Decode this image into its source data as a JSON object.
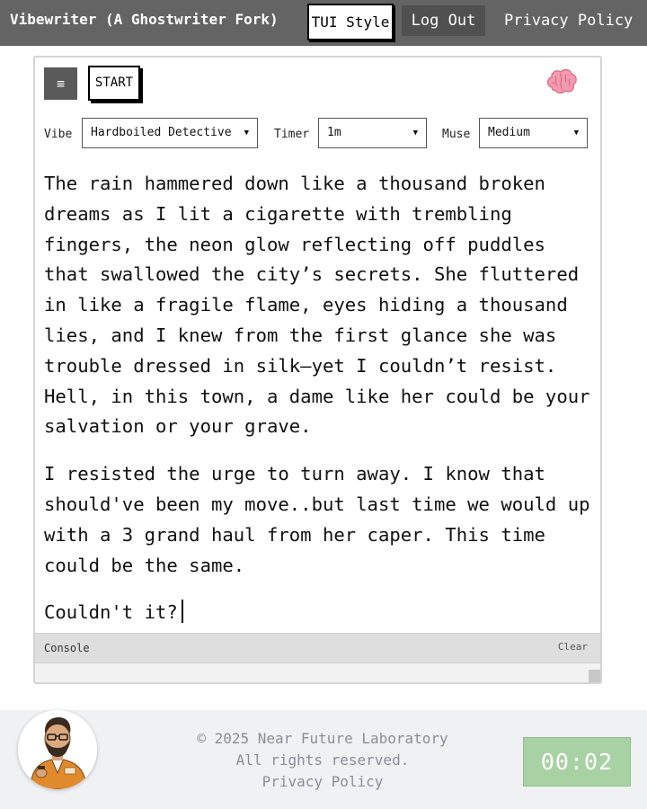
{
  "header": {
    "title": "Vibewriter (A Ghostwriter Fork)",
    "tui_style_label": "TUI Style",
    "logout_label": "Log Out",
    "privacy_label": "Privacy Policy"
  },
  "toolbar": {
    "menu_glyph": "≡",
    "start_label": "START",
    "brain_icon": "brain-icon"
  },
  "controls": {
    "vibe_label": "Vibe",
    "vibe_value": "Hardboiled Detective",
    "timer_label": "Timer",
    "timer_value": "1m",
    "muse_label": "Muse",
    "muse_value": "Medium"
  },
  "editor": {
    "paragraphs": [
      "The rain hammered down like a thousand broken dreams as I lit a cigarette with trembling fingers, the neon glow reflecting off puddles that swallowed the city’s secrets. She fluttered in like a fragile flame, eyes hiding a thousand lies, and I knew from the first glance she was trouble dressed in silk—yet I couldn’t resist. Hell, in this town, a dame like her could be your salvation or your grave.",
      "I resisted the urge to turn away. I know that should've been my move..but last time we would up with a 3 grand haul from her caper. This time could be the same.",
      "Couldn't it?"
    ]
  },
  "console": {
    "label": "Console",
    "clear_label": "Clear"
  },
  "footer": {
    "copyright": "© 2025 Near Future Laboratory",
    "rights": "All rights reserved.",
    "privacy_label": "Privacy Policy",
    "timer_display": "00:02"
  },
  "colors": {
    "header_bg": "#646464",
    "logout_bg": "#505050",
    "timer_bg": "#a9d2a4",
    "footer_bg": "#f0f1f3"
  }
}
